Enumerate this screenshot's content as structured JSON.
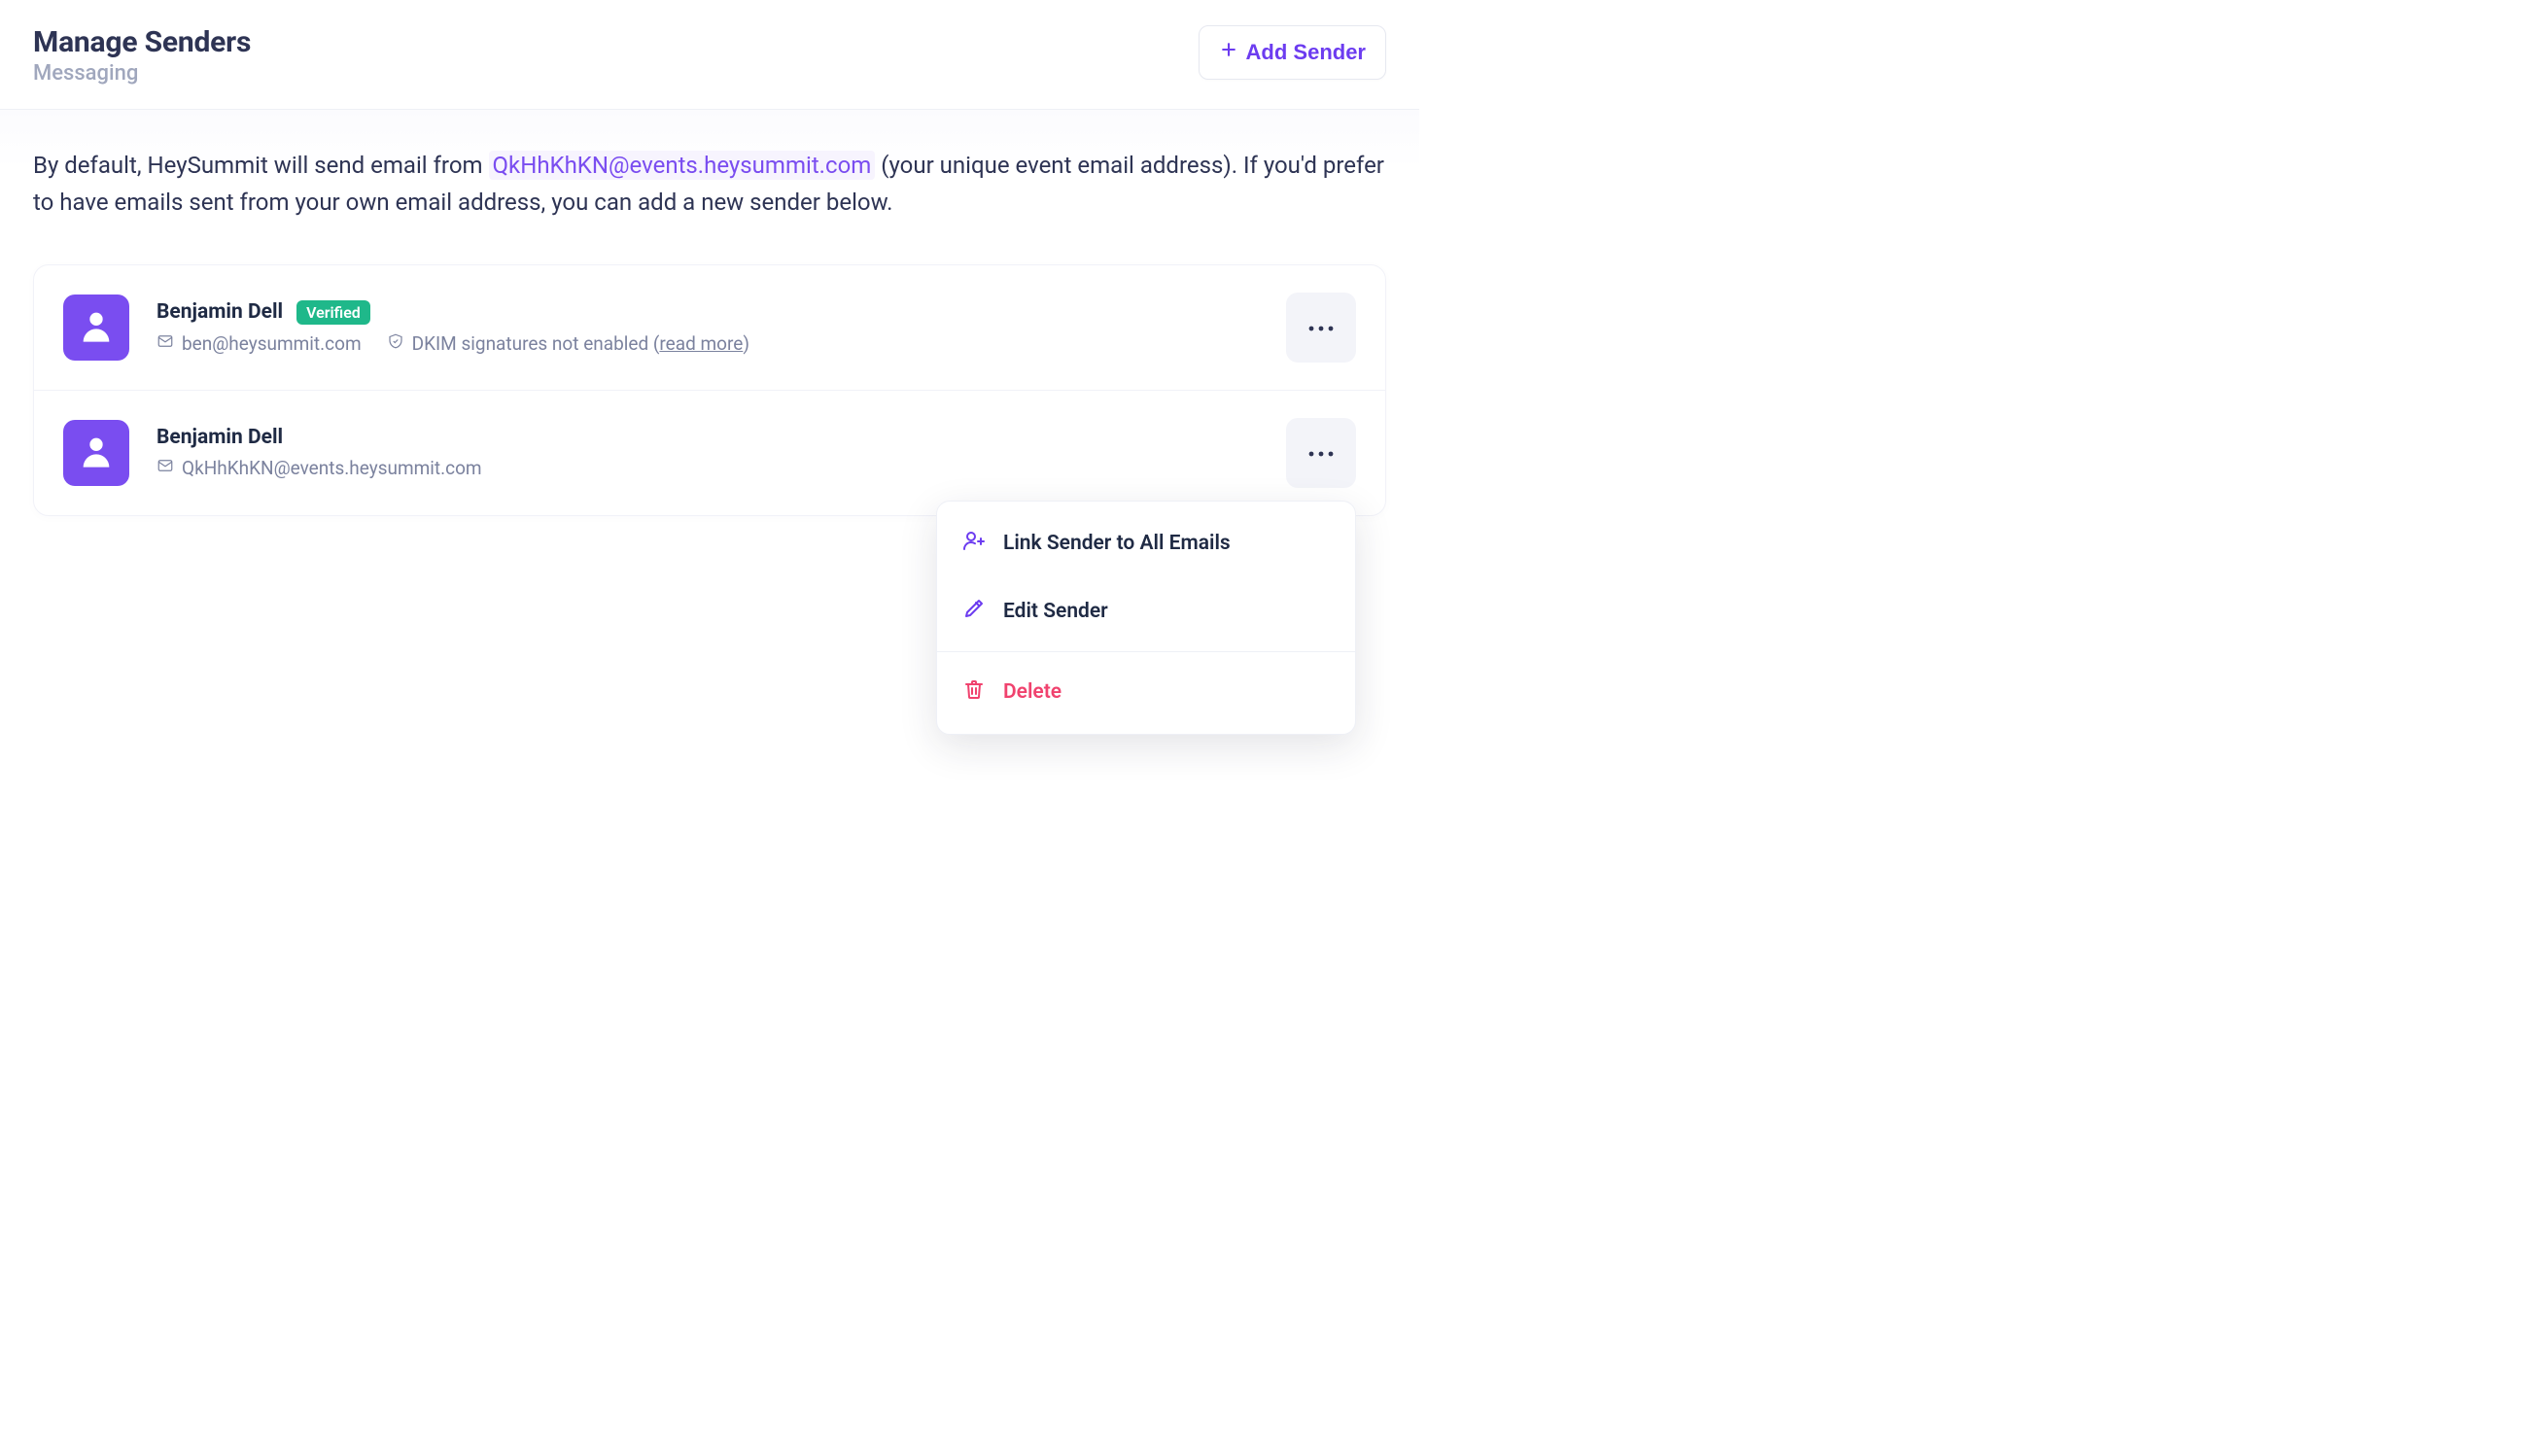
{
  "header": {
    "title": "Manage Senders",
    "subtitle": "Messaging",
    "add_button": "Add Sender"
  },
  "intro": {
    "prefix": "By default, HeySummit will send email from ",
    "default_email": "QkHhKhKN@events.heysummit.com",
    "suffix": " (your unique event email address). If you'd prefer to have emails sent from your own email address, you can add a new sender below."
  },
  "senders": [
    {
      "name": "Benjamin Dell",
      "email": "ben@heysummit.com",
      "verified_label": "Verified",
      "dkim_text": "DKIM signatures not enabled (",
      "read_more": "read more",
      "dkim_close": ")",
      "has_verified": true,
      "has_dkim": true
    },
    {
      "name": "Benjamin Dell",
      "email": "QkHhKhKN@events.heysummit.com",
      "has_verified": false,
      "has_dkim": false
    }
  ],
  "dropdown": {
    "link_all": "Link Sender to All Emails",
    "edit": "Edit Sender",
    "delete": "Delete"
  }
}
